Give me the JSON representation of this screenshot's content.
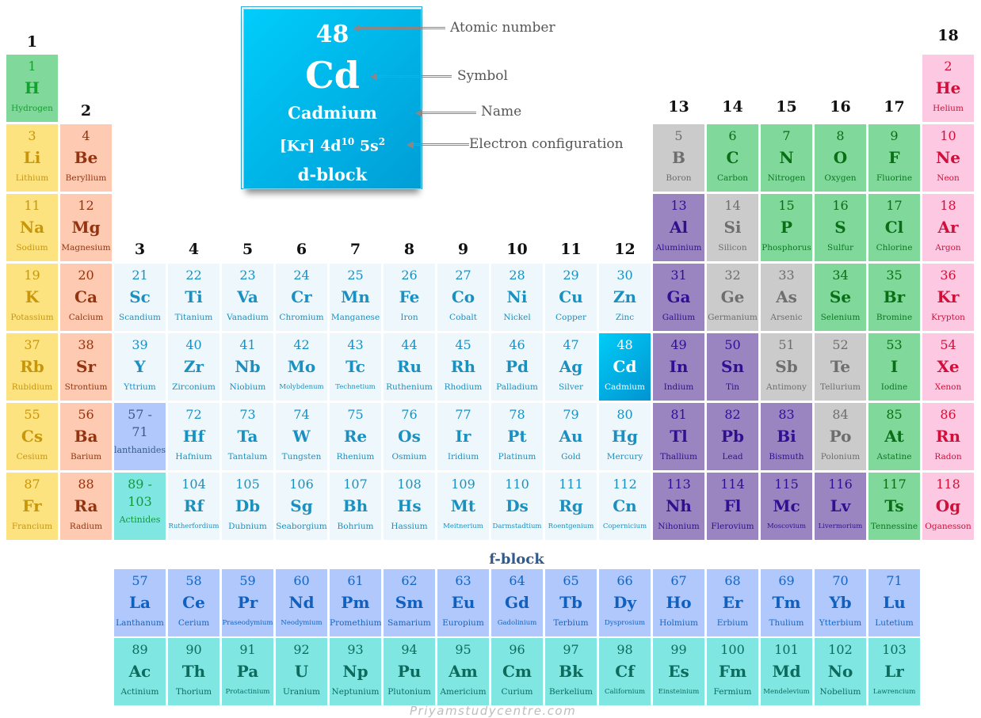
{
  "legend": {
    "atomic_number": "48",
    "symbol": "Cd",
    "name": "Cadmium",
    "config_core": "[Kr] 4d",
    "config_sup1": "10",
    "config_mid": " 5s",
    "config_sup2": "2",
    "block": "d-block",
    "annotations": {
      "atomic_number": "Atomic number",
      "symbol": "Symbol",
      "name": "Name",
      "config": "Electron configuration"
    }
  },
  "group_labels": [
    "1",
    "2",
    "3",
    "4",
    "5",
    "6",
    "7",
    "8",
    "9",
    "10",
    "11",
    "12",
    "13",
    "14",
    "15",
    "16",
    "17",
    "18"
  ],
  "fblock_title": "f-block",
  "watermark": "Priyamstudycentre.com",
  "colors": {
    "highlight": "#00b6e8",
    "alkali": "#fde380",
    "alkaline_earth": "#fecbb2",
    "transition": "#eef8fc",
    "metalloid": "#cbcbcb",
    "post_transition": "#9b85c0",
    "nonmetal": "#80d89b",
    "noble_gas": "#fdc8e2",
    "lanthanide": "#b0c8fc",
    "actinide": "#80e6e2"
  },
  "elements": [
    {
      "n": "1",
      "s": "H",
      "name": "Hydrogen",
      "col": 1,
      "row": 1,
      "cat": "hydrogen"
    },
    {
      "n": "2",
      "s": "He",
      "name": "Helium",
      "col": 18,
      "row": 1,
      "cat": "noble"
    },
    {
      "n": "3",
      "s": "Li",
      "name": "Lithium",
      "col": 1,
      "row": 2,
      "cat": "alkali"
    },
    {
      "n": "4",
      "s": "Be",
      "name": "Beryllium",
      "col": 2,
      "row": 2,
      "cat": "alkaline"
    },
    {
      "n": "5",
      "s": "B",
      "name": "Boron",
      "col": 13,
      "row": 2,
      "cat": "metalloid"
    },
    {
      "n": "6",
      "s": "C",
      "name": "Carbon",
      "col": 14,
      "row": 2,
      "cat": "nonmetal"
    },
    {
      "n": "7",
      "s": "N",
      "name": "Nitrogen",
      "col": 15,
      "row": 2,
      "cat": "nonmetal"
    },
    {
      "n": "8",
      "s": "O",
      "name": "Oxygen",
      "col": 16,
      "row": 2,
      "cat": "nonmetal"
    },
    {
      "n": "9",
      "s": "F",
      "name": "Fluorine",
      "col": 17,
      "row": 2,
      "cat": "nonmetal"
    },
    {
      "n": "10",
      "s": "Ne",
      "name": "Neon",
      "col": 18,
      "row": 2,
      "cat": "noble"
    },
    {
      "n": "11",
      "s": "Na",
      "name": "Sodium",
      "col": 1,
      "row": 3,
      "cat": "alkali"
    },
    {
      "n": "12",
      "s": "Mg",
      "name": "Magnesium",
      "col": 2,
      "row": 3,
      "cat": "alkaline"
    },
    {
      "n": "13",
      "s": "Al",
      "name": "Aluminium",
      "col": 13,
      "row": 3,
      "cat": "post"
    },
    {
      "n": "14",
      "s": "Si",
      "name": "Silicon",
      "col": 14,
      "row": 3,
      "cat": "metalloid"
    },
    {
      "n": "15",
      "s": "P",
      "name": "Phosphorus",
      "col": 15,
      "row": 3,
      "cat": "nonmetal"
    },
    {
      "n": "16",
      "s": "S",
      "name": "Sulfur",
      "col": 16,
      "row": 3,
      "cat": "nonmetal"
    },
    {
      "n": "17",
      "s": "Cl",
      "name": "Chlorine",
      "col": 17,
      "row": 3,
      "cat": "nonmetal"
    },
    {
      "n": "18",
      "s": "Ar",
      "name": "Argon",
      "col": 18,
      "row": 3,
      "cat": "noble"
    },
    {
      "n": "19",
      "s": "K",
      "name": "Potassium",
      "col": 1,
      "row": 4,
      "cat": "alkali"
    },
    {
      "n": "20",
      "s": "Ca",
      "name": "Calcium",
      "col": 2,
      "row": 4,
      "cat": "alkaline"
    },
    {
      "n": "21",
      "s": "Sc",
      "name": "Scandium",
      "col": 3,
      "row": 4,
      "cat": "trans"
    },
    {
      "n": "22",
      "s": "Ti",
      "name": "Titanium",
      "col": 4,
      "row": 4,
      "cat": "trans"
    },
    {
      "n": "23",
      "s": "Va",
      "name": "Vanadium",
      "col": 5,
      "row": 4,
      "cat": "trans"
    },
    {
      "n": "24",
      "s": "Cr",
      "name": "Chromium",
      "col": 6,
      "row": 4,
      "cat": "trans"
    },
    {
      "n": "25",
      "s": "Mn",
      "name": "Manganese",
      "col": 7,
      "row": 4,
      "cat": "trans"
    },
    {
      "n": "26",
      "s": "Fe",
      "name": "Iron",
      "col": 8,
      "row": 4,
      "cat": "trans"
    },
    {
      "n": "27",
      "s": "Co",
      "name": "Cobalt",
      "col": 9,
      "row": 4,
      "cat": "trans"
    },
    {
      "n": "28",
      "s": "Ni",
      "name": "Nickel",
      "col": 10,
      "row": 4,
      "cat": "trans"
    },
    {
      "n": "29",
      "s": "Cu",
      "name": "Copper",
      "col": 11,
      "row": 4,
      "cat": "trans"
    },
    {
      "n": "30",
      "s": "Zn",
      "name": "Zinc",
      "col": 12,
      "row": 4,
      "cat": "trans"
    },
    {
      "n": "31",
      "s": "Ga",
      "name": "Gallium",
      "col": 13,
      "row": 4,
      "cat": "post"
    },
    {
      "n": "32",
      "s": "Ge",
      "name": "Germanium",
      "col": 14,
      "row": 4,
      "cat": "metalloid"
    },
    {
      "n": "33",
      "s": "As",
      "name": "Arsenic",
      "col": 15,
      "row": 4,
      "cat": "metalloid"
    },
    {
      "n": "34",
      "s": "Se",
      "name": "Selenium",
      "col": 16,
      "row": 4,
      "cat": "nonmetal"
    },
    {
      "n": "35",
      "s": "Br",
      "name": "Bromine",
      "col": 17,
      "row": 4,
      "cat": "nonmetal"
    },
    {
      "n": "36",
      "s": "Kr",
      "name": "Krypton",
      "col": 18,
      "row": 4,
      "cat": "noble"
    },
    {
      "n": "37",
      "s": "Rb",
      "name": "Rubidium",
      "col": 1,
      "row": 5,
      "cat": "alkali"
    },
    {
      "n": "38",
      "s": "Sr",
      "name": "Strontium",
      "col": 2,
      "row": 5,
      "cat": "alkaline"
    },
    {
      "n": "39",
      "s": "Y",
      "name": "Yttrium",
      "col": 3,
      "row": 5,
      "cat": "trans"
    },
    {
      "n": "40",
      "s": "Zr",
      "name": "Zirconium",
      "col": 4,
      "row": 5,
      "cat": "trans"
    },
    {
      "n": "41",
      "s": "Nb",
      "name": "Niobium",
      "col": 5,
      "row": 5,
      "cat": "trans"
    },
    {
      "n": "42",
      "s": "Mo",
      "name": "Molybdenum",
      "col": 6,
      "row": 5,
      "cat": "trans",
      "small": true
    },
    {
      "n": "43",
      "s": "Tc",
      "name": "Technetium",
      "col": 7,
      "row": 5,
      "cat": "trans",
      "small": true
    },
    {
      "n": "44",
      "s": "Ru",
      "name": "Ruthenium",
      "col": 8,
      "row": 5,
      "cat": "trans"
    },
    {
      "n": "45",
      "s": "Rh",
      "name": "Rhodium",
      "col": 9,
      "row": 5,
      "cat": "trans"
    },
    {
      "n": "46",
      "s": "Pd",
      "name": "Palladium",
      "col": 10,
      "row": 5,
      "cat": "trans"
    },
    {
      "n": "47",
      "s": "Ag",
      "name": "Silver",
      "col": 11,
      "row": 5,
      "cat": "trans"
    },
    {
      "n": "48",
      "s": "Cd",
      "name": "Cadmium",
      "col": 12,
      "row": 5,
      "cat": "highlight"
    },
    {
      "n": "49",
      "s": "In",
      "name": "Indium",
      "col": 13,
      "row": 5,
      "cat": "post"
    },
    {
      "n": "50",
      "s": "Sn",
      "name": "Tin",
      "col": 14,
      "row": 5,
      "cat": "post"
    },
    {
      "n": "51",
      "s": "Sb",
      "name": "Antimony",
      "col": 15,
      "row": 5,
      "cat": "metalloid"
    },
    {
      "n": "52",
      "s": "Te",
      "name": "Tellurium",
      "col": 16,
      "row": 5,
      "cat": "metalloid"
    },
    {
      "n": "53",
      "s": "I",
      "name": "Iodine",
      "col": 17,
      "row": 5,
      "cat": "nonmetal"
    },
    {
      "n": "54",
      "s": "Xe",
      "name": "Xenon",
      "col": 18,
      "row": 5,
      "cat": "noble"
    },
    {
      "n": "55",
      "s": "Cs",
      "name": "Cesium",
      "col": 1,
      "row": 6,
      "cat": "alkali"
    },
    {
      "n": "56",
      "s": "Ba",
      "name": "Barium",
      "col": 2,
      "row": 6,
      "cat": "alkaline"
    },
    {
      "n": "72",
      "s": "Hf",
      "name": "Hafnium",
      "col": 4,
      "row": 6,
      "cat": "trans"
    },
    {
      "n": "73",
      "s": "Ta",
      "name": "Tantalum",
      "col": 5,
      "row": 6,
      "cat": "trans"
    },
    {
      "n": "74",
      "s": "W",
      "name": "Tungsten",
      "col": 6,
      "row": 6,
      "cat": "trans"
    },
    {
      "n": "75",
      "s": "Re",
      "name": "Rhenium",
      "col": 7,
      "row": 6,
      "cat": "trans"
    },
    {
      "n": "76",
      "s": "Os",
      "name": "Osmium",
      "col": 8,
      "row": 6,
      "cat": "trans"
    },
    {
      "n": "77",
      "s": "Ir",
      "name": "Iridium",
      "col": 9,
      "row": 6,
      "cat": "trans"
    },
    {
      "n": "78",
      "s": "Pt",
      "name": "Platinum",
      "col": 10,
      "row": 6,
      "cat": "trans"
    },
    {
      "n": "79",
      "s": "Au",
      "name": "Gold",
      "col": 11,
      "row": 6,
      "cat": "trans"
    },
    {
      "n": "80",
      "s": "Hg",
      "name": "Mercury",
      "col": 12,
      "row": 6,
      "cat": "trans"
    },
    {
      "n": "81",
      "s": "Tl",
      "name": "Thallium",
      "col": 13,
      "row": 6,
      "cat": "post"
    },
    {
      "n": "82",
      "s": "Pb",
      "name": "Lead",
      "col": 14,
      "row": 6,
      "cat": "post"
    },
    {
      "n": "83",
      "s": "Bi",
      "name": "Bismuth",
      "col": 15,
      "row": 6,
      "cat": "post"
    },
    {
      "n": "84",
      "s": "Po",
      "name": "Polonium",
      "col": 16,
      "row": 6,
      "cat": "metalloid"
    },
    {
      "n": "85",
      "s": "At",
      "name": "Astatine",
      "col": 17,
      "row": 6,
      "cat": "nonmetal"
    },
    {
      "n": "86",
      "s": "Rn",
      "name": "Radon",
      "col": 18,
      "row": 6,
      "cat": "noble"
    },
    {
      "n": "87",
      "s": "Fr",
      "name": "Francium",
      "col": 1,
      "row": 7,
      "cat": "alkali"
    },
    {
      "n": "88",
      "s": "Ra",
      "name": "Radium",
      "col": 2,
      "row": 7,
      "cat": "alkaline"
    },
    {
      "n": "104",
      "s": "Rf",
      "name": "Rutherfordium",
      "col": 4,
      "row": 7,
      "cat": "trans",
      "small": true
    },
    {
      "n": "105",
      "s": "Db",
      "name": "Dubnium",
      "col": 5,
      "row": 7,
      "cat": "trans"
    },
    {
      "n": "106",
      "s": "Sg",
      "name": "Seaborgium",
      "col": 6,
      "row": 7,
      "cat": "trans"
    },
    {
      "n": "107",
      "s": "Bh",
      "name": "Bohrium",
      "col": 7,
      "row": 7,
      "cat": "trans"
    },
    {
      "n": "108",
      "s": "Hs",
      "name": "Hassium",
      "col": 8,
      "row": 7,
      "cat": "trans"
    },
    {
      "n": "109",
      "s": "Mt",
      "name": "Meitnerium",
      "col": 9,
      "row": 7,
      "cat": "trans",
      "small": true
    },
    {
      "n": "110",
      "s": "Ds",
      "name": "Darmstadtium",
      "col": 10,
      "row": 7,
      "cat": "trans",
      "small": true
    },
    {
      "n": "111",
      "s": "Rg",
      "name": "Roentgenium",
      "col": 11,
      "row": 7,
      "cat": "trans",
      "small": true
    },
    {
      "n": "112",
      "s": "Cn",
      "name": "Copernicium",
      "col": 12,
      "row": 7,
      "cat": "trans",
      "small": true
    },
    {
      "n": "113",
      "s": "Nh",
      "name": "Nihonium",
      "col": 13,
      "row": 7,
      "cat": "post"
    },
    {
      "n": "114",
      "s": "Fl",
      "name": "Flerovium",
      "col": 14,
      "row": 7,
      "cat": "post"
    },
    {
      "n": "115",
      "s": "Mc",
      "name": "Moscovium",
      "col": 15,
      "row": 7,
      "cat": "post",
      "small": true
    },
    {
      "n": "116",
      "s": "Lv",
      "name": "Livermorium",
      "col": 16,
      "row": 7,
      "cat": "post",
      "small": true
    },
    {
      "n": "117",
      "s": "Ts",
      "name": "Tennessine",
      "col": 17,
      "row": 7,
      "cat": "nonmetal"
    },
    {
      "n": "118",
      "s": "Og",
      "name": "Oganesson",
      "col": 18,
      "row": 7,
      "cat": "noble"
    }
  ],
  "placeholders": [
    {
      "range1": "57 -",
      "range2": "71",
      "label": "lanthanides",
      "col": 3,
      "row": 6,
      "cat": "lanph"
    },
    {
      "range1": "89 -",
      "range2": "103",
      "label": "Actinides",
      "col": 3,
      "row": 7,
      "cat": "actph"
    }
  ],
  "lanthanides": [
    {
      "n": "57",
      "s": "La",
      "name": "Lanthanum"
    },
    {
      "n": "58",
      "s": "Ce",
      "name": "Cerium"
    },
    {
      "n": "59",
      "s": "Pr",
      "name": "Praseodymium",
      "small": true
    },
    {
      "n": "60",
      "s": "Nd",
      "name": "Neodymium",
      "small": true
    },
    {
      "n": "61",
      "s": "Pm",
      "name": "Promethium"
    },
    {
      "n": "62",
      "s": "Sm",
      "name": "Samarium"
    },
    {
      "n": "63",
      "s": "Eu",
      "name": "Europium"
    },
    {
      "n": "64",
      "s": "Gd",
      "name": "Gadolinium",
      "small": true
    },
    {
      "n": "65",
      "s": "Tb",
      "name": "Terbium"
    },
    {
      "n": "66",
      "s": "Dy",
      "name": "Dysprosium",
      "small": true
    },
    {
      "n": "67",
      "s": "Ho",
      "name": "Holmium"
    },
    {
      "n": "68",
      "s": "Er",
      "name": "Erbium"
    },
    {
      "n": "69",
      "s": "Tm",
      "name": "Thulium"
    },
    {
      "n": "70",
      "s": "Yb",
      "name": "Ytterbium"
    },
    {
      "n": "71",
      "s": "Lu",
      "name": "Lutetium"
    }
  ],
  "actinides": [
    {
      "n": "89",
      "s": "Ac",
      "name": "Actinium"
    },
    {
      "n": "90",
      "s": "Th",
      "name": "Thorium"
    },
    {
      "n": "91",
      "s": "Pa",
      "name": "Protactinium",
      "small": true
    },
    {
      "n": "92",
      "s": "U",
      "name": "Uranium"
    },
    {
      "n": "93",
      "s": "Np",
      "name": "Neptunium"
    },
    {
      "n": "94",
      "s": "Pu",
      "name": "Plutonium"
    },
    {
      "n": "95",
      "s": "Am",
      "name": "Americium"
    },
    {
      "n": "96",
      "s": "Cm",
      "name": "Curium"
    },
    {
      "n": "97",
      "s": "Bk",
      "name": "Berkelium"
    },
    {
      "n": "98",
      "s": "Cf",
      "name": "Californium",
      "small": true
    },
    {
      "n": "99",
      "s": "Es",
      "name": "Einsteinium",
      "small": true
    },
    {
      "n": "100",
      "s": "Fm",
      "name": "Fermium"
    },
    {
      "n": "101",
      "s": "Md",
      "name": "Mendelevium",
      "small": true
    },
    {
      "n": "102",
      "s": "No",
      "name": "Nobelium"
    },
    {
      "n": "103",
      "s": "Lr",
      "name": "Lawrencium",
      "small": true
    }
  ]
}
